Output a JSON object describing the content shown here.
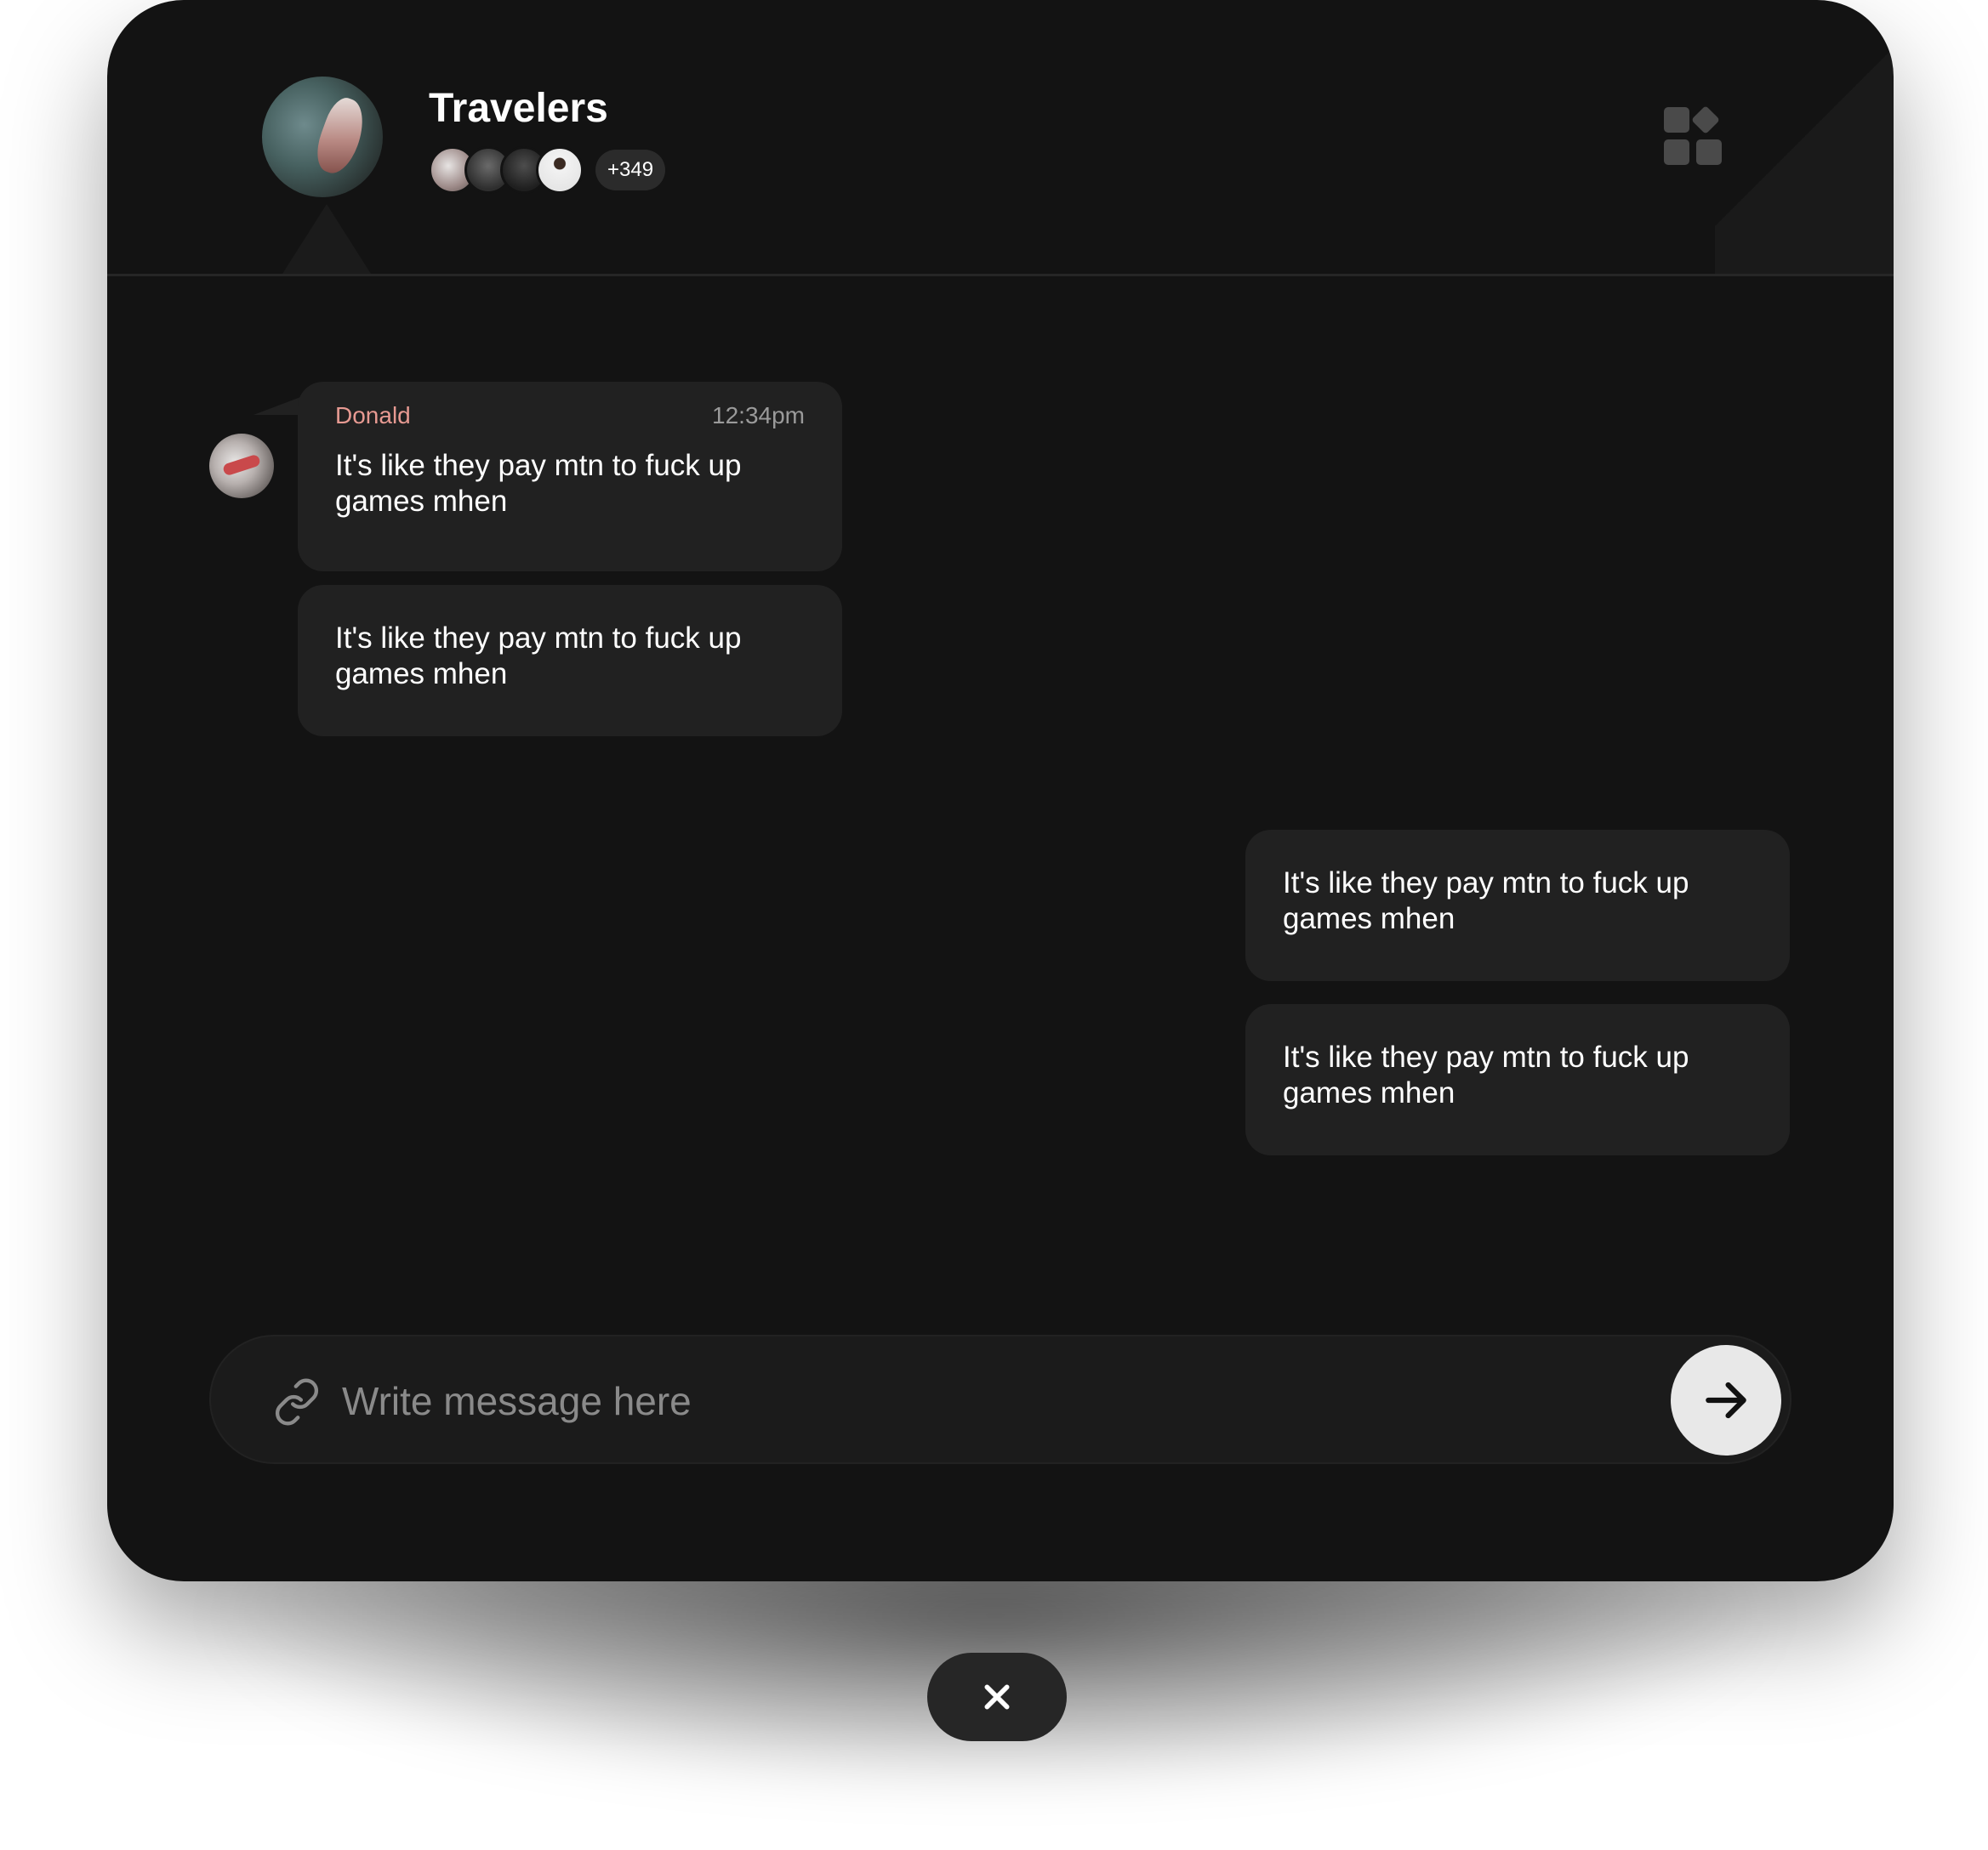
{
  "header": {
    "title": "Travelers",
    "member_count_label": "+349"
  },
  "messages": {
    "incoming": [
      {
        "sender": "Donald",
        "time": "12:34pm",
        "text": "It's like they pay mtn to fuck up games mhen"
      },
      {
        "text": "It's like they pay mtn to fuck up games mhen"
      }
    ],
    "outgoing": [
      {
        "text": "It's like they pay mtn to fuck up games mhen"
      },
      {
        "text": "It's like they pay mtn to fuck up games mhen"
      }
    ]
  },
  "composer": {
    "placeholder": "Write message here",
    "value": ""
  },
  "colors": {
    "window_bg": "#131313",
    "bubble_bg": "#212121",
    "sender_name": "#e79a92",
    "send_button": "#e8e8e8"
  },
  "icons": {
    "apps": "apps-grid-icon",
    "attach": "link-icon",
    "send": "arrow-right-icon",
    "close": "close-icon"
  }
}
